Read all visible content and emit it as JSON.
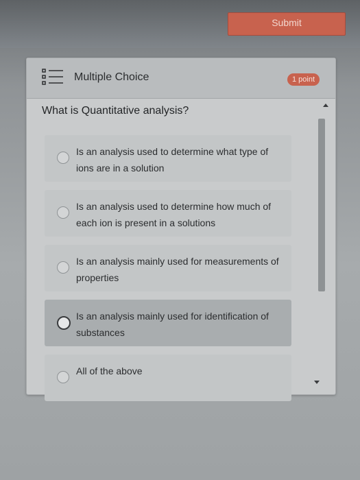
{
  "toolbar": {
    "submit_label": "Submit"
  },
  "question": {
    "type_label": "Multiple Choice",
    "points": "1 point",
    "text": "What is Quantitative analysis?",
    "options": [
      {
        "label": "Is an analysis used to determine what type of ions are in a solution",
        "selected": false
      },
      {
        "label": "Is an analysis used to determine how much of each ion is present in a solutions",
        "selected": false
      },
      {
        "label": "Is an analysis mainly used for measurements of properties",
        "selected": false
      },
      {
        "label": "Is an analysis mainly used for identification of substances",
        "selected": true
      },
      {
        "label": "All of the above",
        "selected": false
      }
    ]
  },
  "colors": {
    "accent": "#c8624e",
    "panel": "#c9cbcc"
  },
  "icons": {
    "type_icon": "list-icon"
  }
}
